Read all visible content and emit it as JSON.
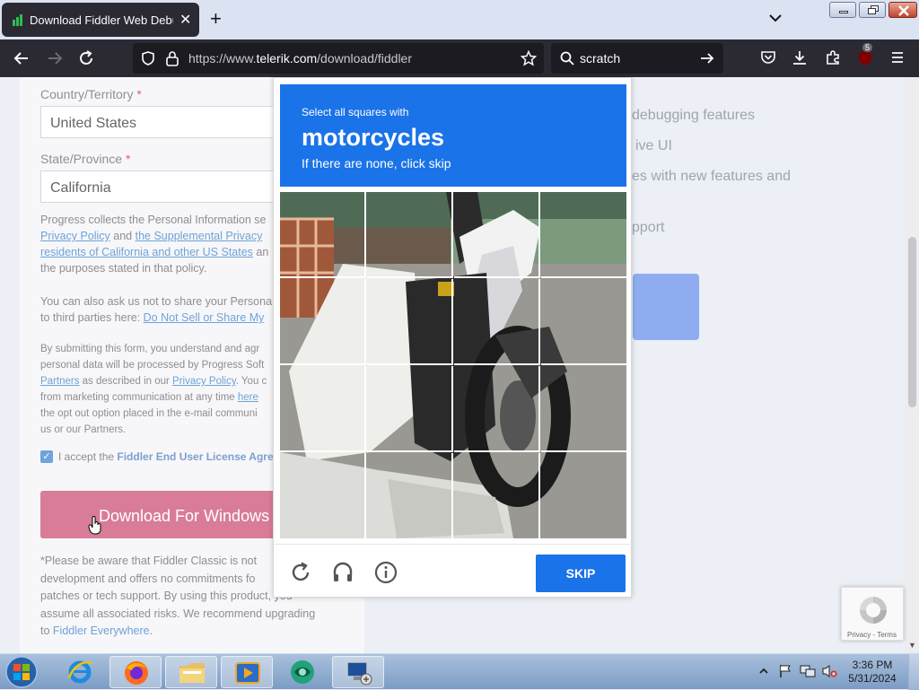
{
  "browser": {
    "tab_title": "Download Fiddler Web Debugg",
    "tab_close": "✕",
    "new_tab": "+",
    "url_prefix": "https://www.",
    "url_domain": "telerik.com",
    "url_path": "/download/fiddler",
    "search_text": "scratch",
    "extension_badge": "5"
  },
  "form": {
    "country_label": "Country/Territory",
    "country_required": "*",
    "country_value": "United States",
    "state_label": "State/Province",
    "state_required": "*",
    "state_value": "California",
    "privacy_p1_a": "Progress collects the Personal Information se",
    "privacy_link1": "Privacy Policy",
    "privacy_and": " and ",
    "privacy_link2": "the Supplemental Privacy",
    "privacy_link3": "residents of California and other US States",
    "privacy_p1_c": " an",
    "privacy_p1_d": "the purposes stated in that policy.",
    "share_p1": "You can also ask us not to share your Persona",
    "share_p2": "to third parties here: ",
    "share_link": "Do Not Sell or Share My",
    "submit_p1": "By submitting this form, you understand and agr",
    "submit_p2": "personal data will be processed by Progress Soft",
    "submit_link_partners": "Partners",
    "submit_p3": " as described in our ",
    "submit_link_privacy": "Privacy Policy",
    "submit_p3b": ". You c",
    "submit_p4": "from marketing communication at any time ",
    "submit_link_here": "here",
    "submit_p5": "the opt out option placed in the e-mail communi",
    "submit_p6": "us or our Partners.",
    "accept_text": "I accept the ",
    "accept_link": "Fiddler End User License Agree",
    "download_button": "Download For Windows",
    "notice_l1": "*Please be aware that Fiddler Classic is not",
    "notice_l2": "development and offers no commitments fo",
    "notice_l3": "patches or tech support. By using this product, you",
    "notice_l4": "assume all associated risks. We recommend upgrading",
    "notice_l5_pre": "to ",
    "notice_link": "Fiddler Everywhere",
    "notice_l5_post": "."
  },
  "right": {
    "line1": "debugging features",
    "line2": "ive UI",
    "line3": "es with new features and",
    "line4": "pport"
  },
  "captcha": {
    "instruction": "Select all squares with",
    "target": "motorcycles",
    "hint": "If there are none, click skip",
    "skip_button": "SKIP"
  },
  "recaptcha": {
    "footer": "Privacy - Terms"
  },
  "taskbar": {
    "time": "3:36 PM",
    "date": "5/31/2024"
  },
  "colors": {
    "accent_blue": "#1a73e8",
    "download_pink": "#d97c98",
    "browser_dark": "#2b2a33"
  }
}
